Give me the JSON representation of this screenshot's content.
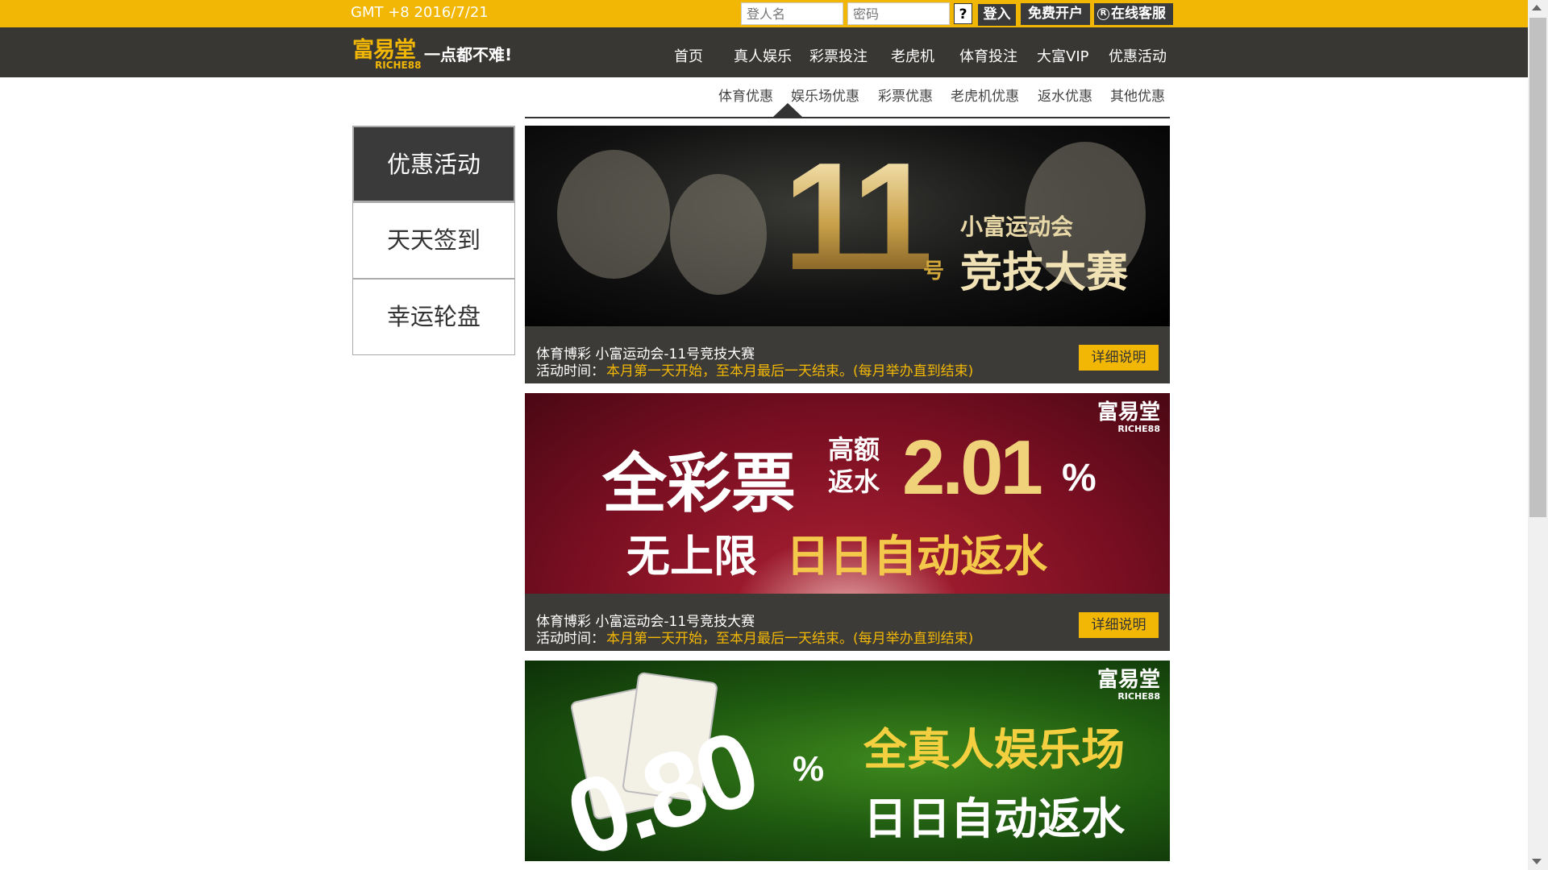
{
  "topbar": {
    "gmt": "GMT +8 2016/7/21",
    "username_placeholder": "登人名",
    "password_placeholder": "密码",
    "help": "?",
    "login": "登入",
    "register": "免费开户",
    "service": "在线客服",
    "service_icon": "R"
  },
  "brand": {
    "logo_main": "富易堂",
    "logo_sub": "RICHE88",
    "slogan": "一点都不难!"
  },
  "nav": {
    "items": [
      "首页",
      "真人娱乐",
      "彩票投注",
      "老虎机",
      "体育投注",
      "大富VIP",
      "优惠活动"
    ]
  },
  "subtabs": {
    "items": [
      "体育优惠",
      "娱乐场优惠",
      "彩票优惠",
      "老虎机优惠",
      "返水优惠",
      "其他优惠"
    ],
    "active_index": 1
  },
  "sidebar": {
    "items": [
      "优惠活动",
      "天天签到",
      "幸运轮盘"
    ],
    "active_index": 0
  },
  "promos": [
    {
      "banner": {
        "big": "11",
        "suffix": "号",
        "line1": "小富运动会",
        "line2": "竞技大赛"
      },
      "title": "体育博彩 小富运动会-11号竞技大赛",
      "time_label": "活动时间：",
      "time": "本月第一天开始，至本月最后一天结束。(每月举办直到结束)",
      "button": "详细说明"
    },
    {
      "banner": {
        "t1": "全彩票",
        "t2a": "高额",
        "t2b": "返水",
        "rate": "2.01",
        "pct": "%",
        "t4": "无上限",
        "t5": "日日自动返水",
        "brand1": "富易堂",
        "brand2": "RICHE88"
      },
      "title": "体育博彩 小富运动会-11号竞技大赛",
      "time_label": "活动时间：",
      "time": "本月第一天开始，至本月最后一天结束。(每月举办直到结束)",
      "button": "详细说明"
    },
    {
      "banner": {
        "rate": "0.80",
        "pct": "%",
        "t1": "全真人娱乐场",
        "t2": "日日自动返水",
        "brand1": "富易堂",
        "brand2": "RICHE88"
      }
    }
  ],
  "colors": {
    "accent": "#f2b705",
    "nav_bg": "#393734",
    "info_bg": "#3d3b38"
  }
}
